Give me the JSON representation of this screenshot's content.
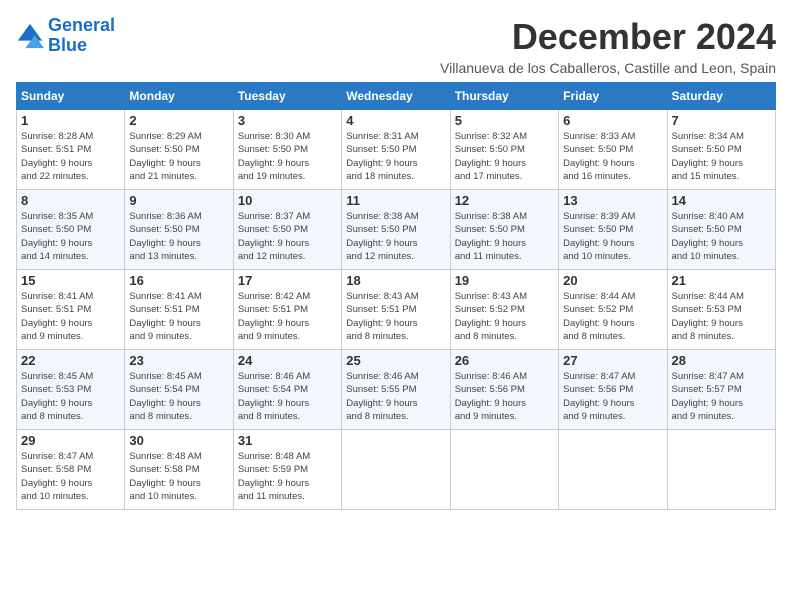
{
  "logo": {
    "line1": "General",
    "line2": "Blue"
  },
  "title": "December 2024",
  "subtitle": "Villanueva de los Caballeros, Castille and Leon, Spain",
  "days_header": [
    "Sunday",
    "Monday",
    "Tuesday",
    "Wednesday",
    "Thursday",
    "Friday",
    "Saturday"
  ],
  "weeks": [
    [
      {
        "day": "1",
        "info": "Sunrise: 8:28 AM\nSunset: 5:51 PM\nDaylight: 9 hours\nand 22 minutes."
      },
      {
        "day": "2",
        "info": "Sunrise: 8:29 AM\nSunset: 5:50 PM\nDaylight: 9 hours\nand 21 minutes."
      },
      {
        "day": "3",
        "info": "Sunrise: 8:30 AM\nSunset: 5:50 PM\nDaylight: 9 hours\nand 19 minutes."
      },
      {
        "day": "4",
        "info": "Sunrise: 8:31 AM\nSunset: 5:50 PM\nDaylight: 9 hours\nand 18 minutes."
      },
      {
        "day": "5",
        "info": "Sunrise: 8:32 AM\nSunset: 5:50 PM\nDaylight: 9 hours\nand 17 minutes."
      },
      {
        "day": "6",
        "info": "Sunrise: 8:33 AM\nSunset: 5:50 PM\nDaylight: 9 hours\nand 16 minutes."
      },
      {
        "day": "7",
        "info": "Sunrise: 8:34 AM\nSunset: 5:50 PM\nDaylight: 9 hours\nand 15 minutes."
      }
    ],
    [
      {
        "day": "8",
        "info": "Sunrise: 8:35 AM\nSunset: 5:50 PM\nDaylight: 9 hours\nand 14 minutes."
      },
      {
        "day": "9",
        "info": "Sunrise: 8:36 AM\nSunset: 5:50 PM\nDaylight: 9 hours\nand 13 minutes."
      },
      {
        "day": "10",
        "info": "Sunrise: 8:37 AM\nSunset: 5:50 PM\nDaylight: 9 hours\nand 12 minutes."
      },
      {
        "day": "11",
        "info": "Sunrise: 8:38 AM\nSunset: 5:50 PM\nDaylight: 9 hours\nand 12 minutes."
      },
      {
        "day": "12",
        "info": "Sunrise: 8:38 AM\nSunset: 5:50 PM\nDaylight: 9 hours\nand 11 minutes."
      },
      {
        "day": "13",
        "info": "Sunrise: 8:39 AM\nSunset: 5:50 PM\nDaylight: 9 hours\nand 10 minutes."
      },
      {
        "day": "14",
        "info": "Sunrise: 8:40 AM\nSunset: 5:50 PM\nDaylight: 9 hours\nand 10 minutes."
      }
    ],
    [
      {
        "day": "15",
        "info": "Sunrise: 8:41 AM\nSunset: 5:51 PM\nDaylight: 9 hours\nand 9 minutes."
      },
      {
        "day": "16",
        "info": "Sunrise: 8:41 AM\nSunset: 5:51 PM\nDaylight: 9 hours\nand 9 minutes."
      },
      {
        "day": "17",
        "info": "Sunrise: 8:42 AM\nSunset: 5:51 PM\nDaylight: 9 hours\nand 9 minutes."
      },
      {
        "day": "18",
        "info": "Sunrise: 8:43 AM\nSunset: 5:51 PM\nDaylight: 9 hours\nand 8 minutes."
      },
      {
        "day": "19",
        "info": "Sunrise: 8:43 AM\nSunset: 5:52 PM\nDaylight: 9 hours\nand 8 minutes."
      },
      {
        "day": "20",
        "info": "Sunrise: 8:44 AM\nSunset: 5:52 PM\nDaylight: 9 hours\nand 8 minutes."
      },
      {
        "day": "21",
        "info": "Sunrise: 8:44 AM\nSunset: 5:53 PM\nDaylight: 9 hours\nand 8 minutes."
      }
    ],
    [
      {
        "day": "22",
        "info": "Sunrise: 8:45 AM\nSunset: 5:53 PM\nDaylight: 9 hours\nand 8 minutes."
      },
      {
        "day": "23",
        "info": "Sunrise: 8:45 AM\nSunset: 5:54 PM\nDaylight: 9 hours\nand 8 minutes."
      },
      {
        "day": "24",
        "info": "Sunrise: 8:46 AM\nSunset: 5:54 PM\nDaylight: 9 hours\nand 8 minutes."
      },
      {
        "day": "25",
        "info": "Sunrise: 8:46 AM\nSunset: 5:55 PM\nDaylight: 9 hours\nand 8 minutes."
      },
      {
        "day": "26",
        "info": "Sunrise: 8:46 AM\nSunset: 5:56 PM\nDaylight: 9 hours\nand 9 minutes."
      },
      {
        "day": "27",
        "info": "Sunrise: 8:47 AM\nSunset: 5:56 PM\nDaylight: 9 hours\nand 9 minutes."
      },
      {
        "day": "28",
        "info": "Sunrise: 8:47 AM\nSunset: 5:57 PM\nDaylight: 9 hours\nand 9 minutes."
      }
    ],
    [
      {
        "day": "29",
        "info": "Sunrise: 8:47 AM\nSunset: 5:58 PM\nDaylight: 9 hours\nand 10 minutes."
      },
      {
        "day": "30",
        "info": "Sunrise: 8:48 AM\nSunset: 5:58 PM\nDaylight: 9 hours\nand 10 minutes."
      },
      {
        "day": "31",
        "info": "Sunrise: 8:48 AM\nSunset: 5:59 PM\nDaylight: 9 hours\nand 11 minutes."
      },
      {
        "day": "",
        "info": ""
      },
      {
        "day": "",
        "info": ""
      },
      {
        "day": "",
        "info": ""
      },
      {
        "day": "",
        "info": ""
      }
    ]
  ]
}
